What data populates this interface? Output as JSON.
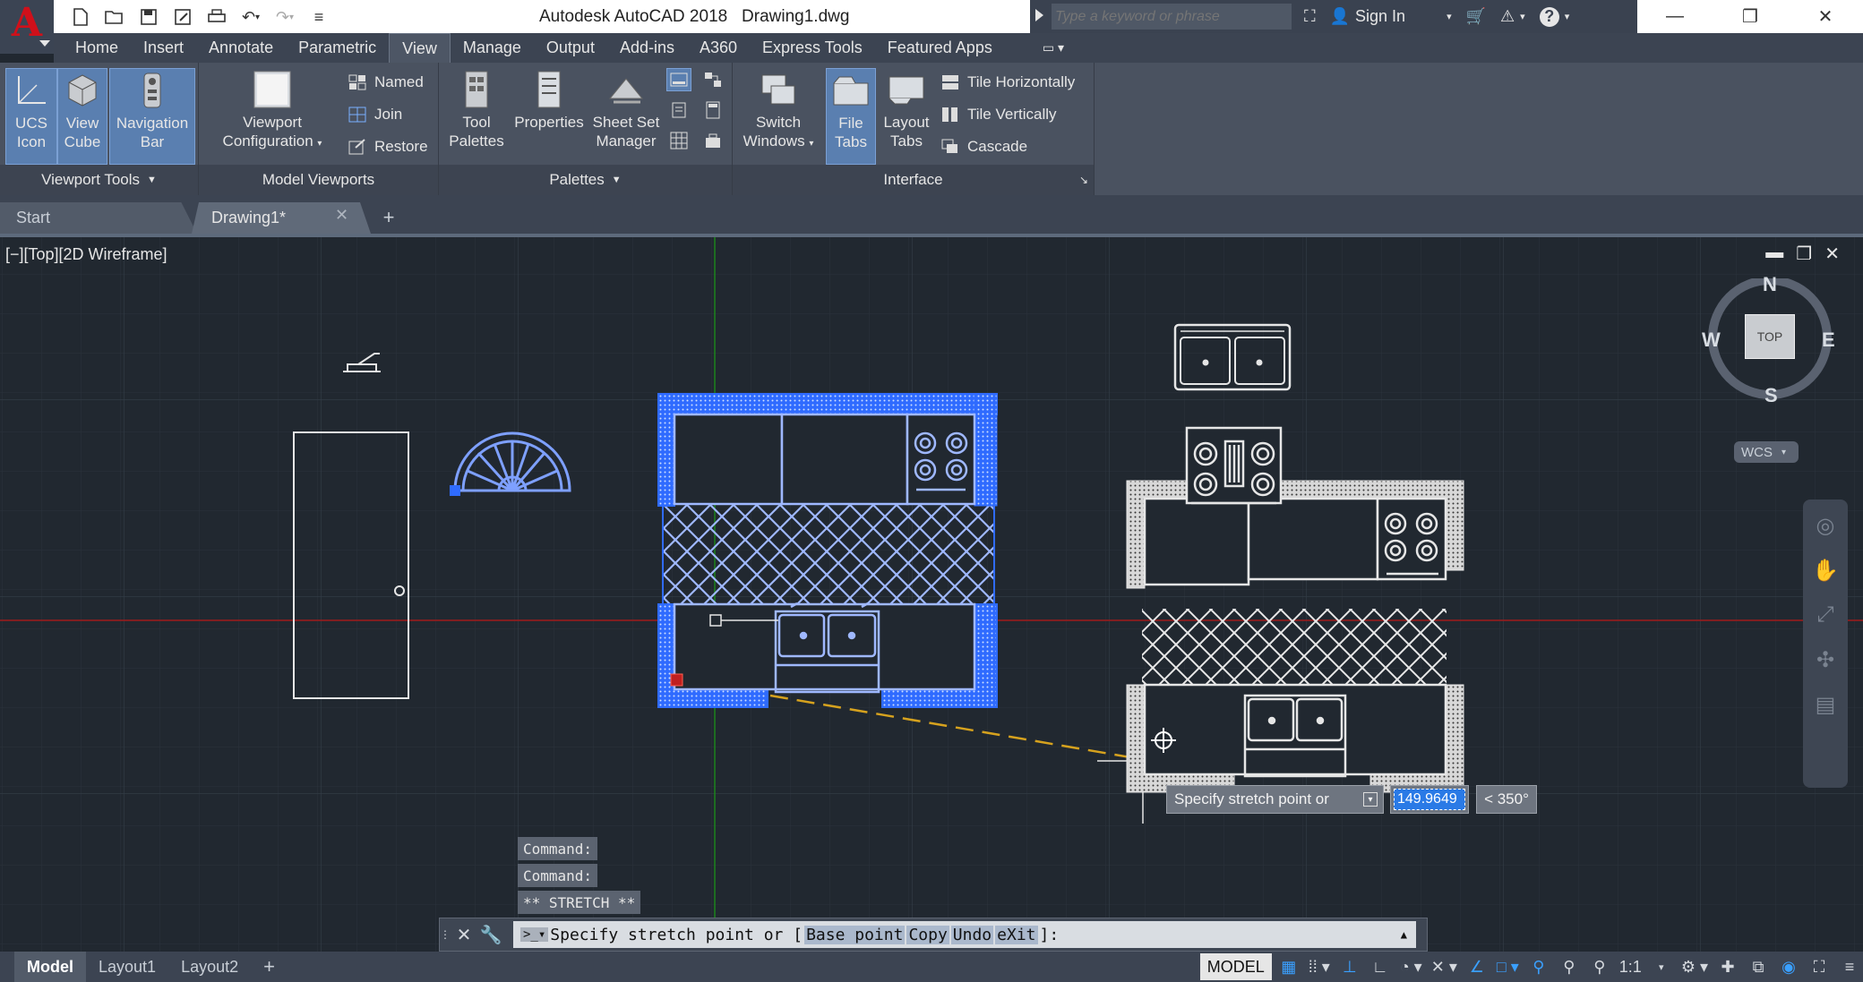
{
  "app": {
    "title": "Autodesk AutoCAD 2018",
    "document": "Drawing1.dwg",
    "logo_letter": "A"
  },
  "search": {
    "placeholder": "Type a keyword or phrase"
  },
  "account": {
    "sign_in": "Sign In"
  },
  "ribbon_tabs": [
    "Home",
    "Insert",
    "Annotate",
    "Parametric",
    "View",
    "Manage",
    "Output",
    "Add-ins",
    "A360",
    "Express Tools",
    "Featured Apps"
  ],
  "active_tab": "View",
  "panels": {
    "viewport_tools": {
      "title": "Viewport Tools",
      "buttons": [
        {
          "label1": "UCS",
          "label2": "Icon"
        },
        {
          "label1": "View",
          "label2": "Cube"
        },
        {
          "label1": "Navigation",
          "label2": "Bar"
        }
      ]
    },
    "model_viewports": {
      "title": "Model Viewports",
      "big": {
        "label1": "Viewport",
        "label2": "Configuration"
      },
      "small": [
        "Named",
        "Join",
        "Restore"
      ]
    },
    "palettes": {
      "title": "Palettes",
      "buttons": [
        {
          "label1": "Tool",
          "label2": "Palettes"
        },
        {
          "label1": "Properties",
          "label2": ""
        },
        {
          "label1": "Sheet Set",
          "label2": "Manager"
        }
      ]
    },
    "interface": {
      "title": "Interface",
      "buttons": [
        {
          "label1": "Switch",
          "label2": "Windows"
        },
        {
          "label1": "File",
          "label2": "Tabs"
        },
        {
          "label1": "Layout",
          "label2": "Tabs"
        }
      ],
      "small": [
        "Tile Horizontally",
        "Tile Vertically",
        "Cascade"
      ]
    }
  },
  "file_tabs": {
    "start": "Start",
    "drawing": "Drawing1*"
  },
  "viewport": {
    "label": "[−][Top][2D Wireframe]"
  },
  "viewcube": {
    "n": "N",
    "s": "S",
    "e": "E",
    "w": "W",
    "face": "TOP",
    "wcs": "WCS"
  },
  "dynamic_input": {
    "prompt": "Specify stretch point or",
    "value": "149.9649",
    "angle": "< 350°"
  },
  "command_history": [
    "Command:",
    "Command:",
    "** STRETCH **"
  ],
  "command_line": {
    "prompt": "Specify stretch point or [",
    "options": [
      "Base point",
      "Copy",
      "Undo",
      "eXit"
    ],
    "suffix": "]:"
  },
  "layout_tabs": [
    "Model",
    "Layout1",
    "Layout2"
  ],
  "status": {
    "model": "MODEL",
    "scale": "1:1"
  },
  "colors": {
    "selection": "#2f6bff",
    "crosshair_x": "#a01a1a",
    "crosshair_y": "#1a8a1a",
    "rubberband": "#d6a21e"
  }
}
